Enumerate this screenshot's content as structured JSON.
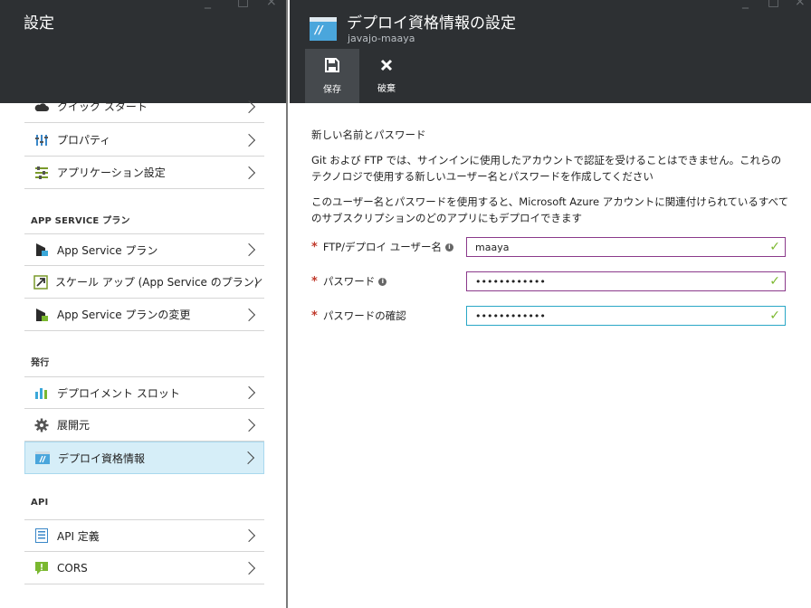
{
  "left_blade": {
    "title": "設定",
    "window_controls": [
      "_",
      "□",
      "×"
    ],
    "partial_item": {
      "label": "クイック スタート"
    },
    "items_top": [
      {
        "label": "プロパティ",
        "icon": "properties-icon"
      },
      {
        "label": "アプリケーション設定",
        "icon": "app-settings-icon"
      }
    ],
    "groups": [
      {
        "title": "APP SERVICE プラン",
        "items": [
          {
            "label": "App Service プラン",
            "icon": "app-service-plan-icon"
          },
          {
            "label": "スケール アップ (App Service のプラン)",
            "icon": "scale-up-icon"
          },
          {
            "label": "App Service プランの変更",
            "icon": "change-plan-icon"
          }
        ]
      },
      {
        "title": "発行",
        "items": [
          {
            "label": "デプロイメント スロット",
            "icon": "deployment-slots-icon"
          },
          {
            "label": "展開元",
            "icon": "gear-icon"
          },
          {
            "label": "デプロイ資格情報",
            "icon": "deploy-credentials-icon",
            "selected": true
          }
        ]
      },
      {
        "title": "API",
        "items": [
          {
            "label": "API 定義",
            "icon": "api-definition-icon"
          },
          {
            "label": "CORS",
            "icon": "cors-icon"
          }
        ]
      }
    ]
  },
  "right_blade": {
    "title": "デプロイ資格情報の設定",
    "subtitle": "javajo-maaya",
    "window_controls": [
      "_",
      "□",
      "×"
    ],
    "commands": [
      {
        "label": "保存",
        "icon": "save-icon"
      },
      {
        "label": "破棄",
        "icon": "discard-icon"
      }
    ],
    "section_title": "新しい名前とパスワード",
    "para1": "Git および FTP では、サインインに使用したアカウントで認証を受けることはできません。これらのテクノロジで使用する新しいユーザー名とパスワードを作成してください",
    "para2": "このユーザー名とパスワードを使用すると、Microsoft Azure アカウントに関連付けられているすべてのサブスクリプションのどのアプリにもデプロイできます",
    "fields": [
      {
        "label": "FTP/デプロイ ユーザー名",
        "value": "maaya",
        "required": "*",
        "has_info": true
      },
      {
        "label": "パスワード",
        "value": "••••••••••••",
        "required": "*",
        "has_info": true
      },
      {
        "label": "パスワードの確認",
        "value": "••••••••••••",
        "required": "*",
        "has_info": false
      }
    ]
  },
  "colors": {
    "header_bg": "#2d3033",
    "selected_item_bg": "#d6eef8",
    "valid_check": "#7cb82f",
    "required_star": "#c0392b",
    "input_border": "#8b3a8b",
    "input_focus_border": "#2aa7c6"
  }
}
